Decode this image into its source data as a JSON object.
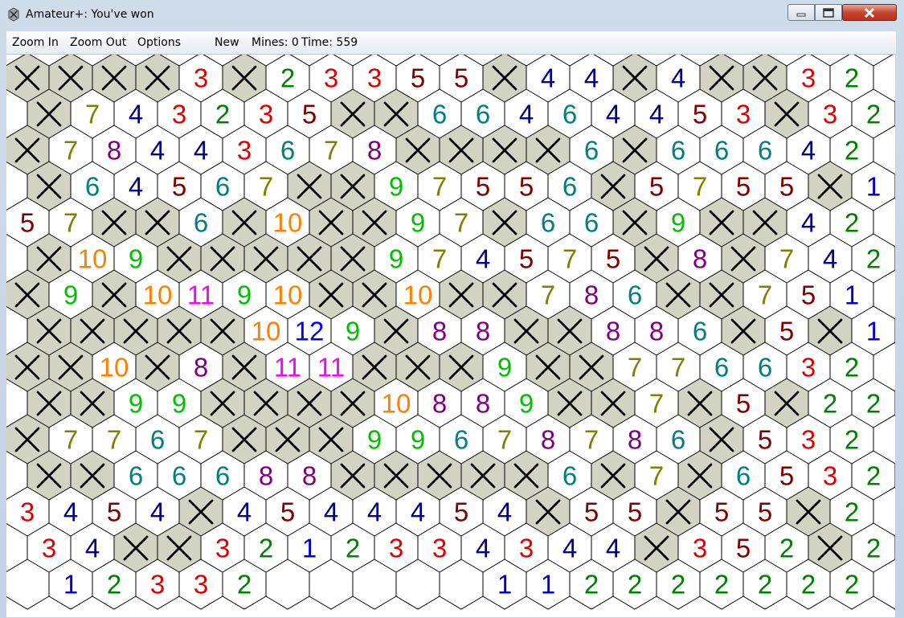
{
  "window": {
    "title": "Amateur+: You've won"
  },
  "menu": {
    "zoom_in": "Zoom In",
    "zoom_out": "Zoom Out",
    "options": "Options",
    "new": "New",
    "mines": "Mines: 0",
    "time": "Time: 559"
  },
  "colors": {
    "mine_fill": "#d3d3c3",
    "cell_fill": "#ffffff",
    "grid_line": "#000000",
    "n1": "#0000cc",
    "n2": "#008000",
    "n3": "#e00000",
    "n4": "#000080",
    "n5": "#800000",
    "n6": "#008080",
    "n7": "#808000",
    "n8": "#800080",
    "n9": "#00c000",
    "n10": "#ff8000",
    "n11": "#ff00ff",
    "n12": "#0000ff"
  },
  "board": {
    "rows": [
      [
        "X",
        "X",
        "X",
        "X",
        "3",
        "X",
        "2",
        "3",
        "3",
        "5",
        "5",
        "X",
        "4",
        "4",
        "X",
        "4",
        "X",
        "X",
        "3",
        "2",
        " "
      ],
      [
        " ",
        "X",
        "7",
        "4",
        "3",
        "2",
        "3",
        "5",
        "X",
        "X",
        "6",
        "6",
        "4",
        "6",
        "4",
        "4",
        "5",
        "3",
        "X",
        "3",
        "2"
      ],
      [
        "X",
        "7",
        "8",
        "4",
        "4",
        "3",
        "6",
        "7",
        "8",
        "X",
        "X",
        "X",
        "X",
        "6",
        "X",
        "6",
        "6",
        "6",
        "4",
        "2",
        " "
      ],
      [
        " ",
        "X",
        "6",
        "4",
        "5",
        "6",
        "7",
        "X",
        "X",
        "9",
        "7",
        "5",
        "5",
        "6",
        "X",
        "5",
        "7",
        "5",
        "5",
        "X",
        "1"
      ],
      [
        "5",
        "7",
        "X",
        "X",
        "6",
        "X",
        "10",
        "X",
        "X",
        "9",
        "7",
        "X",
        "6",
        "6",
        "X",
        "9",
        "X",
        "X",
        "4",
        "2",
        " "
      ],
      [
        " ",
        "X",
        "10",
        "9",
        "X",
        "X",
        "X",
        "X",
        "X",
        "9",
        "7",
        "4",
        "5",
        "7",
        "5",
        "X",
        "8",
        "X",
        "7",
        "4",
        "2"
      ],
      [
        "X",
        "9",
        "X",
        "10",
        "11",
        "9",
        "10",
        "X",
        "X",
        "10",
        "X",
        "X",
        "7",
        "8",
        "6",
        "X",
        "X",
        "7",
        "5",
        "1",
        " "
      ],
      [
        " ",
        "X",
        "X",
        "X",
        "X",
        "X",
        "10",
        "12",
        "9",
        "X",
        "8",
        "8",
        "X",
        "X",
        "8",
        "8",
        "6",
        "X",
        "5",
        "X",
        "1"
      ],
      [
        "X",
        "X",
        "10",
        "X",
        "8",
        "X",
        "11",
        "11",
        "X",
        "X",
        "X",
        "9",
        "X",
        "X",
        "7",
        "7",
        "6",
        "6",
        "3",
        "2",
        " "
      ],
      [
        " ",
        "X",
        "X",
        "9",
        "9",
        "X",
        "X",
        "X",
        "X",
        "10",
        "8",
        "8",
        "9",
        "X",
        "X",
        "7",
        "X",
        "5",
        "X",
        "2",
        "2"
      ],
      [
        "X",
        "7",
        "7",
        "6",
        "7",
        "X",
        "X",
        "X",
        "9",
        "9",
        "6",
        "7",
        "8",
        "7",
        "8",
        "6",
        "X",
        "5",
        "3",
        "2",
        " "
      ],
      [
        " ",
        "X",
        "X",
        "6",
        "6",
        "6",
        "8",
        "8",
        "X",
        "X",
        "X",
        "X",
        "X",
        "6",
        "X",
        "7",
        "X",
        "6",
        "5",
        "3",
        "2"
      ],
      [
        "3",
        "4",
        "5",
        "4",
        "X",
        "4",
        "5",
        "4",
        "4",
        "4",
        "5",
        "4",
        "X",
        "5",
        "5",
        "X",
        "5",
        "5",
        "X",
        "2",
        " "
      ],
      [
        " ",
        "3",
        "4",
        "X",
        "X",
        "3",
        "2",
        "1",
        "2",
        "3",
        "3",
        "4",
        "3",
        "4",
        "4",
        "X",
        "3",
        "5",
        "2",
        "X",
        "2"
      ],
      [
        " ",
        "1",
        "2",
        "3",
        "3",
        "2",
        " ",
        " ",
        " ",
        " ",
        " ",
        "1",
        "1",
        "2",
        "2",
        "2",
        "2",
        "2",
        "2",
        "2",
        " "
      ]
    ]
  }
}
